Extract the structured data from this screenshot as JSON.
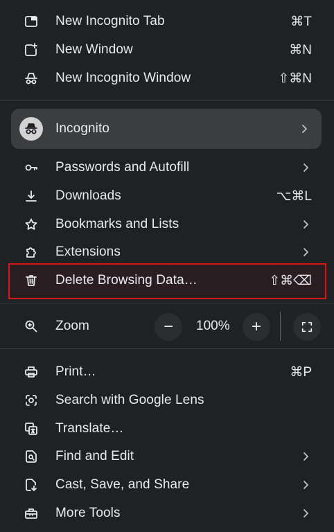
{
  "menu": {
    "top_items": [
      {
        "label": "New Incognito Tab",
        "shortcut": "⌘T",
        "icon": "new-tab-icon"
      },
      {
        "label": "New Window",
        "shortcut": "⌘N",
        "icon": "new-window-icon"
      },
      {
        "label": "New Incognito Window",
        "shortcut": "⇧⌘N",
        "icon": "incognito-icon"
      }
    ],
    "profile": {
      "label": "Incognito",
      "icon": "incognito-avatar-icon"
    },
    "mid_items": [
      {
        "label": "Passwords and Autofill",
        "shortcut": "",
        "icon": "key-icon"
      },
      {
        "label": "Downloads",
        "shortcut": "⌥⌘L",
        "icon": "download-icon"
      },
      {
        "label": "Bookmarks and Lists",
        "shortcut": "",
        "icon": "star-icon"
      },
      {
        "label": "Extensions",
        "shortcut": "",
        "icon": "extension-icon"
      },
      {
        "label": "Delete Browsing Data…",
        "shortcut": "⇧⌘⌫",
        "icon": "trash-icon"
      }
    ],
    "zoom": {
      "label": "Zoom",
      "value": "100%",
      "minus": "−",
      "plus": "+"
    },
    "bottom_items": [
      {
        "label": "Print…",
        "shortcut": "⌘P",
        "icon": "print-icon"
      },
      {
        "label": "Search with Google Lens",
        "shortcut": "",
        "icon": "lens-icon"
      },
      {
        "label": "Translate…",
        "shortcut": "",
        "icon": "translate-icon"
      },
      {
        "label": "Find and Edit",
        "shortcut": "",
        "icon": "find-icon"
      },
      {
        "label": "Cast, Save, and Share",
        "shortcut": "",
        "icon": "cast-save-icon"
      },
      {
        "label": "More Tools",
        "shortcut": "",
        "icon": "toolbox-icon"
      }
    ]
  },
  "colors": {
    "background": "#202124",
    "highlight_border": "#d61818",
    "text": "#e8eaed"
  }
}
